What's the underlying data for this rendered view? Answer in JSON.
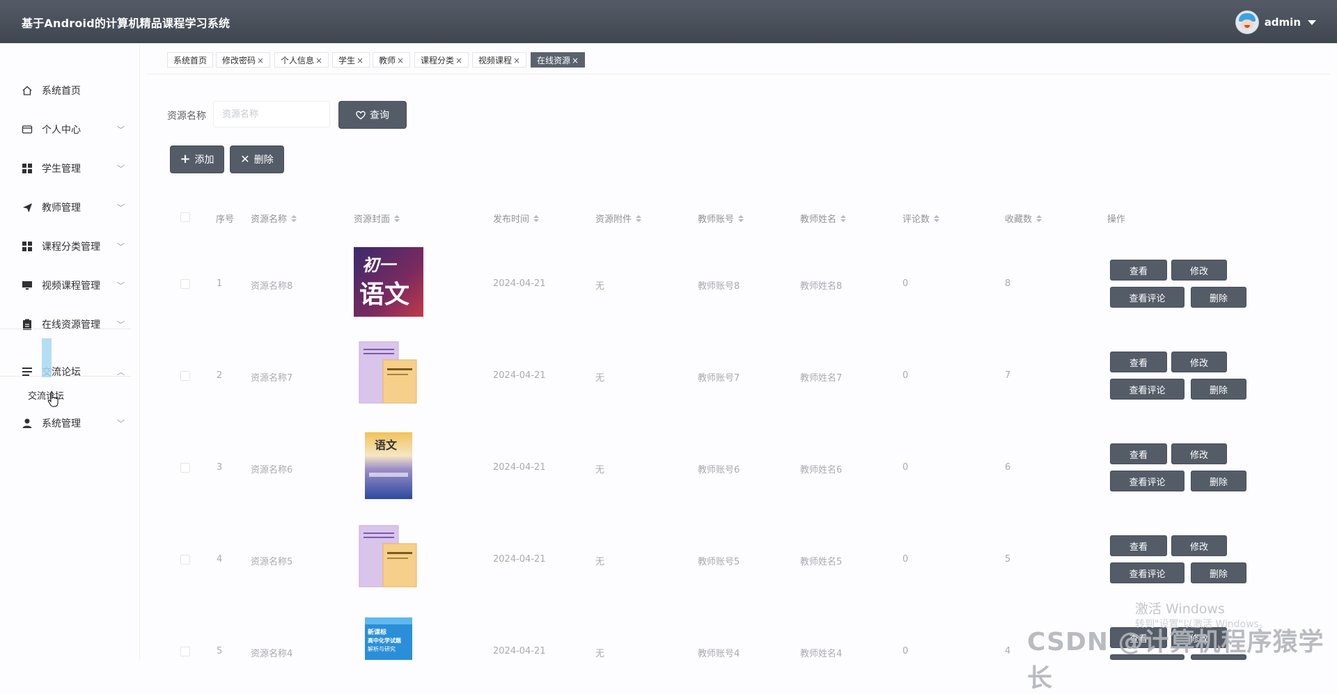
{
  "header": {
    "app_title": "基于Android的计算机精品课程学习系统",
    "username": "admin"
  },
  "sidebar": {
    "items": [
      {
        "label": "系统首页",
        "icon": "home-icon"
      },
      {
        "label": "个人中心",
        "icon": "card-icon"
      },
      {
        "label": "学生管理",
        "icon": "grid-icon"
      },
      {
        "label": "教师管理",
        "icon": "paper-plane-icon"
      },
      {
        "label": "课程分类管理",
        "icon": "grid-icon"
      },
      {
        "label": "视频课程管理",
        "icon": "monitor-icon"
      },
      {
        "label": "在线资源管理",
        "icon": "clipboard-icon"
      },
      {
        "label": "交流论坛",
        "icon": "list-icon"
      },
      {
        "label": "系统管理",
        "icon": "user-icon"
      }
    ],
    "submenu": {
      "label": "交流论坛"
    }
  },
  "tags": [
    {
      "label": "系统首页",
      "closable": false
    },
    {
      "label": "修改密码",
      "closable": true
    },
    {
      "label": "个人信息",
      "closable": true
    },
    {
      "label": "学生",
      "closable": true
    },
    {
      "label": "教师",
      "closable": true
    },
    {
      "label": "课程分类",
      "closable": true
    },
    {
      "label": "视频课程",
      "closable": true
    },
    {
      "label": "在线资源",
      "closable": true,
      "active": true
    }
  ],
  "tag_close": "×",
  "search": {
    "label": "资源名称",
    "placeholder": "资源名称",
    "button": "查询"
  },
  "toolbar": {
    "add": "添加",
    "delete": "删除"
  },
  "table": {
    "columns": [
      "序号",
      "资源名称",
      "资源封面",
      "发布时间",
      "资源附件",
      "教师账号",
      "教师姓名",
      "评论数",
      "收藏数",
      "操作"
    ],
    "rows": [
      {
        "index": "1",
        "name": "资源名称8",
        "cover": "yuwen-grade7",
        "date": "2024-04-21",
        "attachment": "无",
        "teacher_account": "教师账号8",
        "teacher_name": "教师姓名8",
        "comments": "0",
        "favorites": "8"
      },
      {
        "index": "2",
        "name": "资源名称7",
        "cover": "curriculum-standard",
        "date": "2024-04-21",
        "attachment": "无",
        "teacher_account": "教师账号7",
        "teacher_name": "教师姓名7",
        "comments": "0",
        "favorites": "7"
      },
      {
        "index": "3",
        "name": "资源名称6",
        "cover": "yuwen-textbook",
        "date": "2024-04-21",
        "attachment": "无",
        "teacher_account": "教师账号6",
        "teacher_name": "教师姓名6",
        "comments": "0",
        "favorites": "6"
      },
      {
        "index": "4",
        "name": "资源名称5",
        "cover": "curriculum-standard",
        "date": "2024-04-21",
        "attachment": "无",
        "teacher_account": "教师账号5",
        "teacher_name": "教师姓名5",
        "comments": "0",
        "favorites": "5"
      },
      {
        "index": "5",
        "name": "资源名称4",
        "cover": "chemistry-exam",
        "date": "2024-04-21",
        "attachment": "无",
        "teacher_account": "教师账号4",
        "teacher_name": "教师姓名4",
        "comments": "0",
        "favorites": "4"
      }
    ],
    "actions": {
      "view": "查看",
      "edit": "修改",
      "view_comments": "查看评论",
      "delete": "删除"
    }
  },
  "cover_text": {
    "grade7_top": "初一",
    "grade7_bottom": "语文",
    "yuwen": "语文",
    "chem1": "新课标",
    "chem2": "高中化学试题",
    "chem3": "解析与研究"
  },
  "watermark": {
    "activate": "激活 Windows",
    "activate_sub": "转到\"设置\"以激活 Windows。",
    "csdn": "CSDN @计算机程序猿学长"
  }
}
